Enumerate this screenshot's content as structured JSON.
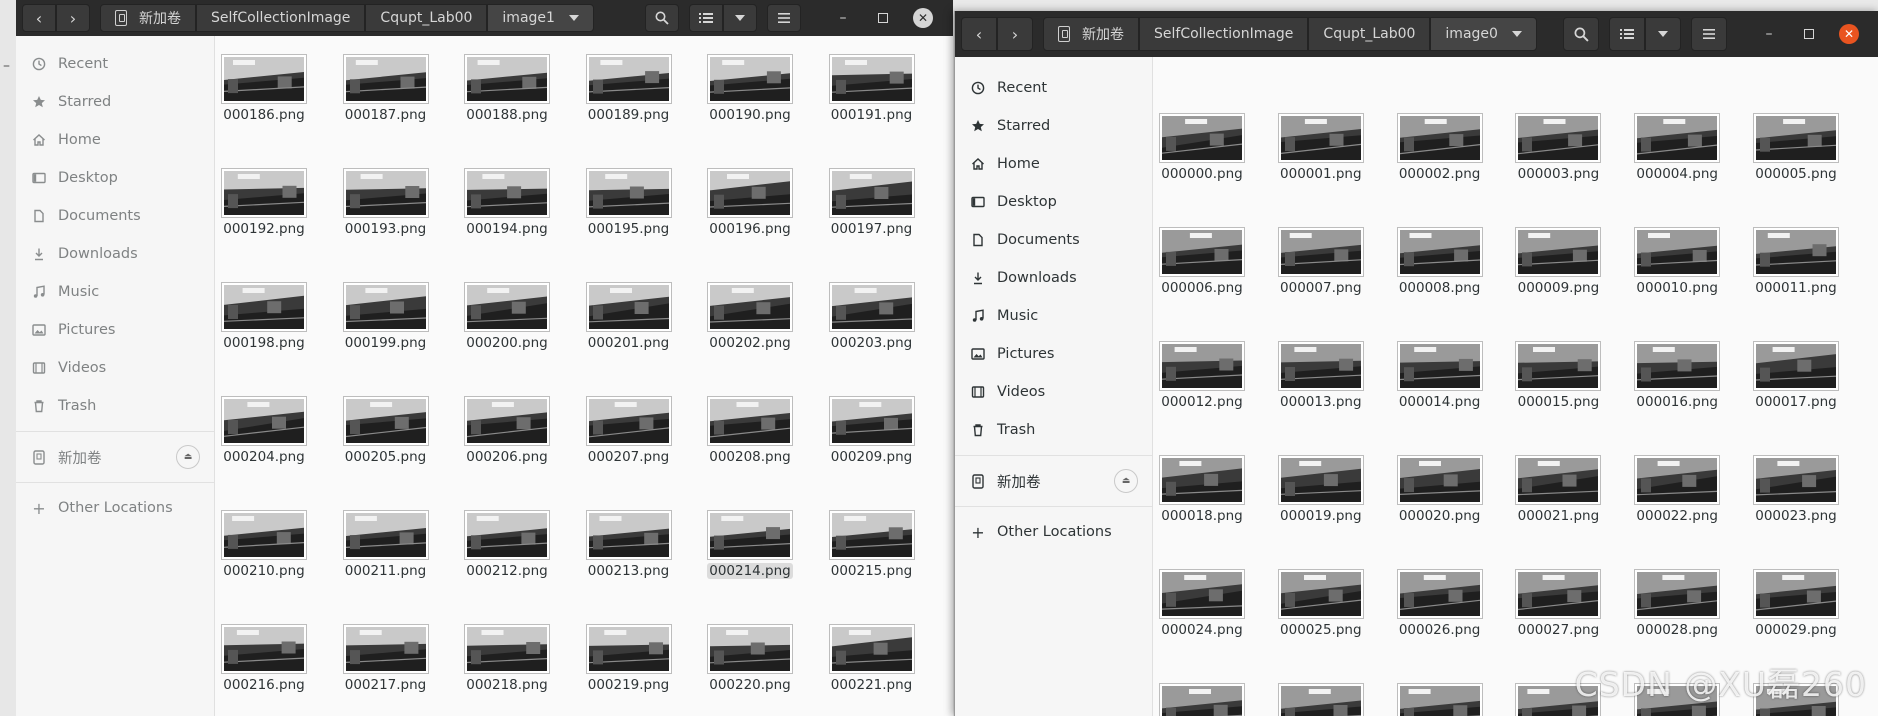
{
  "left": {
    "breadcrumbs": [
      "新加卷",
      "SelfCollectionImage",
      "Cqupt_Lab00",
      "image1"
    ],
    "sidebar": {
      "places": [
        {
          "label": "Recent",
          "icon": "clock-icon"
        },
        {
          "label": "Starred",
          "icon": "star-icon"
        },
        {
          "label": "Home",
          "icon": "home-icon"
        },
        {
          "label": "Desktop",
          "icon": "desktop-icon"
        },
        {
          "label": "Documents",
          "icon": "document-icon"
        },
        {
          "label": "Downloads",
          "icon": "download-icon"
        },
        {
          "label": "Music",
          "icon": "music-icon"
        },
        {
          "label": "Pictures",
          "icon": "picture-icon"
        },
        {
          "label": "Videos",
          "icon": "video-icon"
        },
        {
          "label": "Trash",
          "icon": "trash-icon"
        }
      ],
      "volume": "新加卷",
      "other": "Other Locations"
    },
    "files": [
      "000186.png",
      "000187.png",
      "000188.png",
      "000189.png",
      "000190.png",
      "000191.png",
      "000192.png",
      "000193.png",
      "000194.png",
      "000195.png",
      "000196.png",
      "000197.png",
      "000198.png",
      "000199.png",
      "000200.png",
      "000201.png",
      "000202.png",
      "000203.png",
      "000204.png",
      "000205.png",
      "000206.png",
      "000207.png",
      "000208.png",
      "000209.png",
      "000210.png",
      "000211.png",
      "000212.png",
      "000213.png",
      "000214.png",
      "000215.png",
      "000216.png",
      "000217.png",
      "000218.png",
      "000219.png",
      "000220.png",
      "000221.png"
    ],
    "selected_file": "000214.png"
  },
  "right": {
    "breadcrumbs": [
      "新加卷",
      "SelfCollectionImage",
      "Cqupt_Lab00",
      "image0"
    ],
    "sidebar": {
      "places": [
        {
          "label": "Recent",
          "icon": "clock-icon"
        },
        {
          "label": "Starred",
          "icon": "star-icon"
        },
        {
          "label": "Home",
          "icon": "home-icon"
        },
        {
          "label": "Desktop",
          "icon": "desktop-icon"
        },
        {
          "label": "Documents",
          "icon": "document-icon"
        },
        {
          "label": "Downloads",
          "icon": "download-icon"
        },
        {
          "label": "Music",
          "icon": "music-icon"
        },
        {
          "label": "Pictures",
          "icon": "picture-icon"
        },
        {
          "label": "Videos",
          "icon": "video-icon"
        },
        {
          "label": "Trash",
          "icon": "trash-icon"
        }
      ],
      "volume": "新加卷",
      "other": "Other Locations"
    },
    "files": [
      "000000.png",
      "000001.png",
      "000002.png",
      "000003.png",
      "000004.png",
      "000005.png",
      "000006.png",
      "000007.png",
      "000008.png",
      "000009.png",
      "000010.png",
      "000011.png",
      "000012.png",
      "000013.png",
      "000014.png",
      "000015.png",
      "000016.png",
      "000017.png",
      "000018.png",
      "000019.png",
      "000020.png",
      "000021.png",
      "000022.png",
      "000023.png",
      "000024.png",
      "000025.png",
      "000026.png",
      "000027.png",
      "000028.png",
      "000029.png",
      "",
      "",
      "",
      "",
      "",
      ""
    ]
  },
  "watermark": "CSDN @XU磊260",
  "colors": {
    "headerbar": "#2b2b2b",
    "close_accent": "#e95420",
    "sidebar_bg": "#f6f6f6",
    "content_bg": "#fafafa"
  }
}
